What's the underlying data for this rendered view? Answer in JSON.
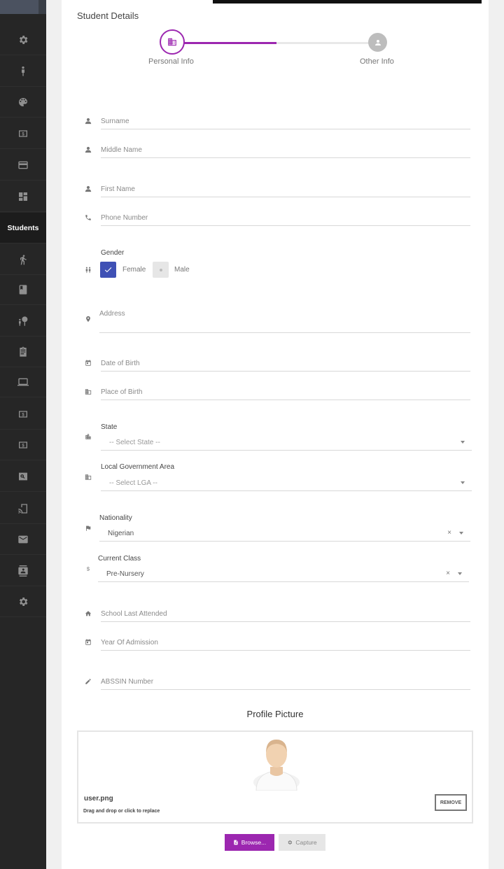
{
  "sidebar": {
    "items": [
      {
        "icon": "gear-icon"
      },
      {
        "icon": "person-icon"
      },
      {
        "icon": "palette-icon"
      },
      {
        "icon": "dollar-icon"
      },
      {
        "icon": "credit-card-icon"
      },
      {
        "icon": "dashboard-icon"
      },
      {
        "label": "Students"
      },
      {
        "icon": "walking-icon"
      },
      {
        "icon": "book-icon"
      },
      {
        "icon": "nature-people-icon"
      },
      {
        "icon": "assignment-icon"
      },
      {
        "icon": "laptop-icon"
      },
      {
        "icon": "dollar-icon"
      },
      {
        "icon": "dollar-icon"
      },
      {
        "icon": "search-icon"
      },
      {
        "icon": "cast-icon"
      },
      {
        "icon": "mail-icon"
      },
      {
        "icon": "contacts-icon"
      },
      {
        "icon": "gear-icon"
      }
    ]
  },
  "card": {
    "title": "Student Details"
  },
  "stepper": {
    "step1": "Personal Info",
    "step2": "Other Info",
    "progress": 0.5
  },
  "form": {
    "surname": "Surname",
    "middle_name": "Middle Name",
    "first_name": "First Name",
    "phone": "Phone Number",
    "gender_label": "Gender",
    "female": "Female",
    "male": "Male",
    "address": "Address",
    "dob": "Date of Birth",
    "pob": "Place of Birth",
    "state_label": "State",
    "state_value": "-- Select State --",
    "lga_label": "Local Government Area",
    "lga_value": "-- Select LGA --",
    "nationality_label": "Nationality",
    "nationality_value": "Nigerian",
    "class_label": "Current Class",
    "class_value": "Pre-Nursery",
    "clear_symbol": "×",
    "school": "School Last Attended",
    "admission": "Year Of Admission",
    "abssin": "ABSSIN Number"
  },
  "profile": {
    "title": "Profile Picture",
    "file_name": "user.png",
    "hint": "Drag and drop or click to replace",
    "remove": "REMOVE",
    "browse": "Browse...",
    "capture": "Capture"
  },
  "colors": {
    "accent": "#9c27b0",
    "checkbox": "#3f51b5",
    "sidebar": "#262626"
  }
}
